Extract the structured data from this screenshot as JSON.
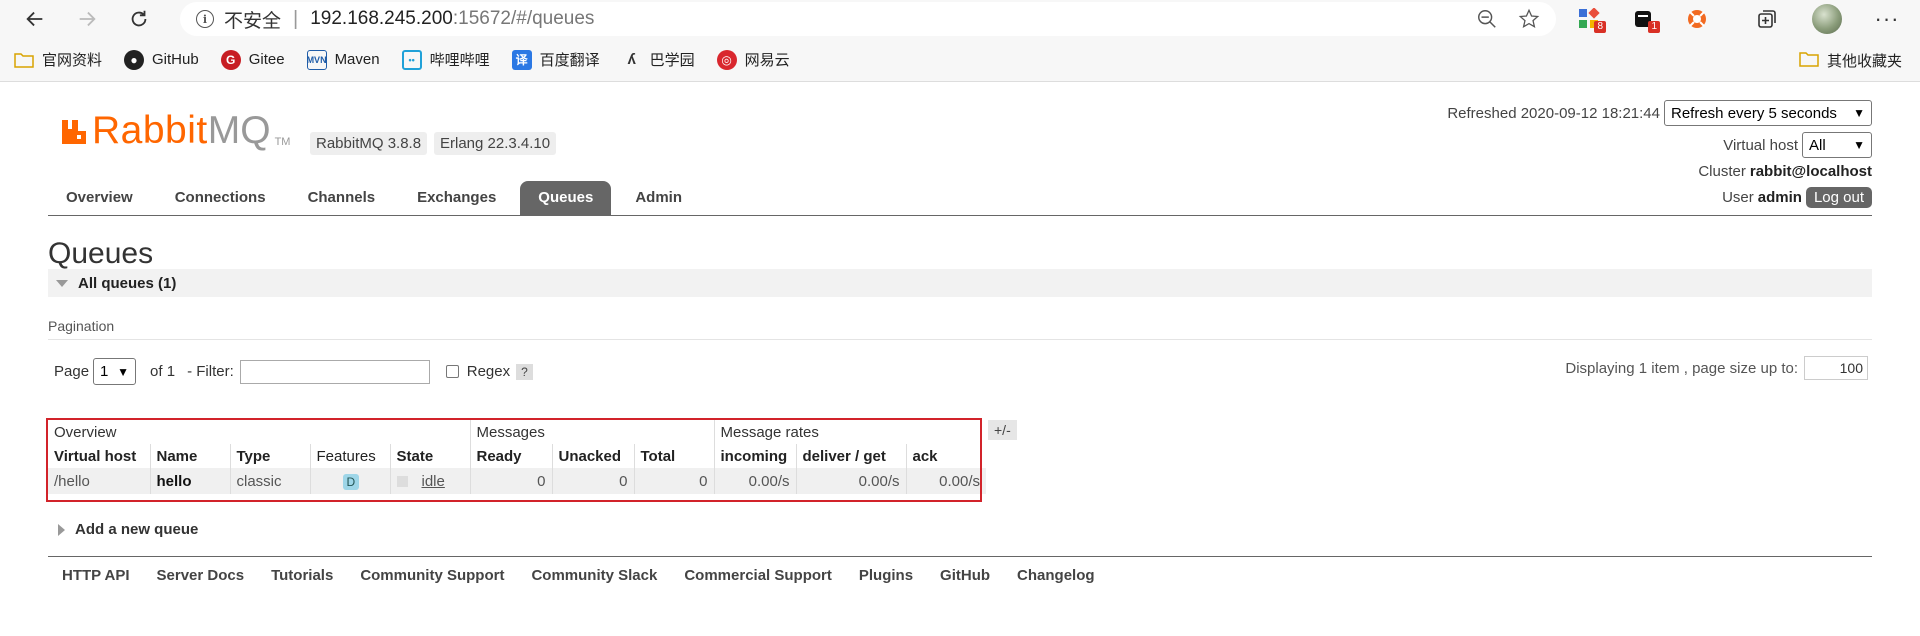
{
  "browser": {
    "security_label": "不安全",
    "url_host": "192.168.245.200",
    "url_path": ":15672/#/queues",
    "ext_badges": [
      "8",
      "1"
    ],
    "bookmarks": [
      {
        "label": "官网资料",
        "icon": "folder-icon"
      },
      {
        "label": "GitHub",
        "icon": "github-icon"
      },
      {
        "label": "Gitee",
        "icon": "gitee-icon"
      },
      {
        "label": "Maven",
        "icon": "maven-icon"
      },
      {
        "label": "哔哩哔哩",
        "icon": "bilibili-icon"
      },
      {
        "label": "百度翻译",
        "icon": "translate-icon"
      },
      {
        "label": "巴学园",
        "icon": "baxueyuan-icon"
      },
      {
        "label": "网易云",
        "icon": "netease-icon"
      }
    ],
    "other_bookmarks": "其他收藏夹"
  },
  "app": {
    "logo_rabbit": "Rabbit",
    "logo_mq": "MQ",
    "logo_tm": "TM",
    "version": "RabbitMQ 3.8.8",
    "erlang": "Erlang 22.3.4.10",
    "refreshed_label": "Refreshed 2020-09-12 18:21:44",
    "refresh_select": "Refresh every 5 seconds",
    "vhost_label": "Virtual host",
    "vhost_value": "All",
    "cluster_label": "Cluster",
    "cluster_value": "rabbit@localhost",
    "user_label": "User",
    "user_value": "admin",
    "logout": "Log out",
    "tabs": [
      "Overview",
      "Connections",
      "Channels",
      "Exchanges",
      "Queues",
      "Admin"
    ],
    "active_tab": "Queues"
  },
  "main": {
    "title": "Queues",
    "section": "All queues (1)",
    "pagination_label": "Pagination",
    "page_label": "Page",
    "page_value": "1",
    "of_label": "of 1",
    "filter_label": "- Filter:",
    "regex_label": "Regex",
    "help": "?",
    "displaying": "Displaying 1 item , page size up to:",
    "page_size": "100",
    "table": {
      "groups": [
        "Overview",
        "Messages",
        "Message rates"
      ],
      "columns": [
        "Virtual host",
        "Name",
        "Type",
        "Features",
        "State",
        "Ready",
        "Unacked",
        "Total",
        "incoming",
        "deliver / get",
        "ack"
      ],
      "row": {
        "vhost": "/hello",
        "name": "hello",
        "type": "classic",
        "features": "D",
        "state": "idle",
        "ready": "0",
        "unacked": "0",
        "total": "0",
        "incoming": "0.00/s",
        "deliver_get": "0.00/s",
        "ack": "0.00/s"
      },
      "plus_minus": "+/-"
    },
    "add_queue": "Add a new queue"
  },
  "footer": [
    "HTTP API",
    "Server Docs",
    "Tutorials",
    "Community Support",
    "Community Slack",
    "Commercial Support",
    "Plugins",
    "GitHub",
    "Changelog"
  ],
  "colors": {
    "brand": "#ff6600",
    "highlight": "#d2232a",
    "tab_active": "#666666"
  }
}
